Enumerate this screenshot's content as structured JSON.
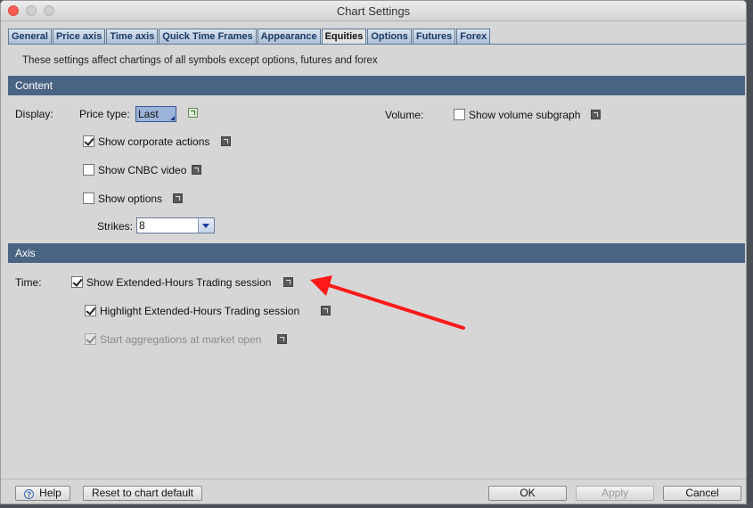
{
  "window": {
    "title": "Chart Settings"
  },
  "tabs": [
    {
      "label": "General"
    },
    {
      "label": "Price axis"
    },
    {
      "label": "Time axis"
    },
    {
      "label": "Quick Time Frames"
    },
    {
      "label": "Appearance"
    },
    {
      "label": "Equities",
      "active": true
    },
    {
      "label": "Options"
    },
    {
      "label": "Futures"
    },
    {
      "label": "Forex"
    }
  ],
  "description": "These settings affect chartings of all symbols except options, futures and forex",
  "content": {
    "header": "Content",
    "display_label": "Display:",
    "price_type_label": "Price type:",
    "price_type_value": "Last",
    "volume_label": "Volume:",
    "show_volume_subgraph": {
      "label": "Show volume subgraph",
      "checked": false
    },
    "show_corporate_actions": {
      "label": "Show corporate actions",
      "checked": true
    },
    "show_cnbc_video": {
      "label": "Show CNBC video",
      "checked": false
    },
    "show_options": {
      "label": "Show options",
      "checked": false
    },
    "strikes_label": "Strikes:",
    "strikes_value": "8"
  },
  "axis": {
    "header": "Axis",
    "time_label": "Time:",
    "show_extended_hours": {
      "label": "Show Extended-Hours Trading session",
      "checked": true
    },
    "highlight_extended_hours": {
      "label": "Highlight Extended-Hours Trading session",
      "checked": true
    },
    "start_aggregations": {
      "label": "Start aggregations at market open",
      "checked": true,
      "disabled": true
    }
  },
  "footer": {
    "help": "Help",
    "reset": "Reset to chart default",
    "ok": "OK",
    "apply": "Apply",
    "cancel": "Cancel"
  },
  "colors": {
    "section_header": "#4a6584",
    "tab_text": "#1b3a66",
    "annotation_arrow": "#ff1a1a"
  }
}
